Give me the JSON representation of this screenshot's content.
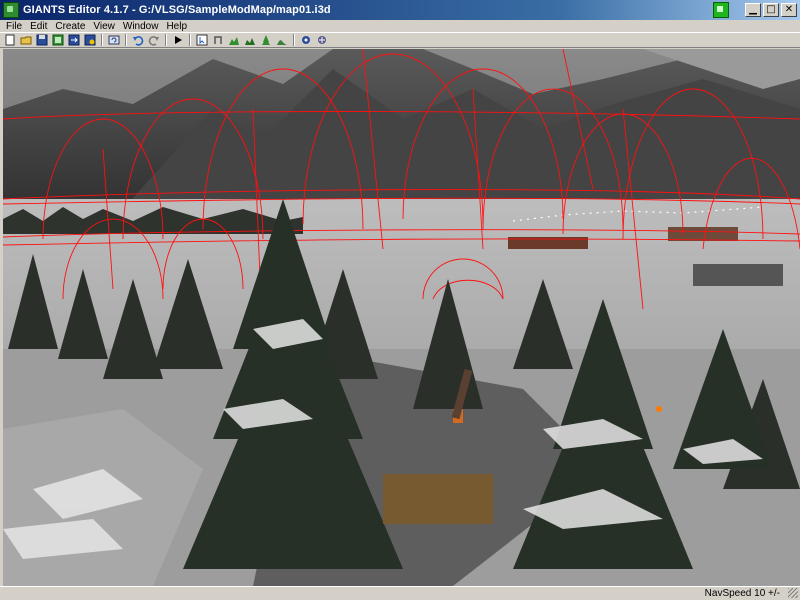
{
  "window": {
    "title": "GIANTS Editor 4.1.7 - G:/VLSG/SampleModMap/map01.i3d",
    "minimize_glyph": "▁",
    "maximize_glyph": "□",
    "close_glyph": "✕"
  },
  "menu": [
    {
      "label": "File"
    },
    {
      "label": "Edit"
    },
    {
      "label": "Create"
    },
    {
      "label": "View"
    },
    {
      "label": "Window"
    },
    {
      "label": "Help"
    }
  ],
  "toolbar": {
    "groups": [
      [
        "new-file-icon",
        "open-file-icon",
        "save-icon",
        "import-icon",
        "export-icon",
        "save-as-icon"
      ],
      [
        "reload-icon"
      ],
      [
        "undo-icon",
        "redo-icon"
      ],
      [
        "play-icon"
      ],
      [
        "select-icon",
        "move-icon",
        "terrain-sculpt-icon",
        "terrain-paint-icon",
        "foliage-paint-icon",
        "terrain-smooth-icon"
      ],
      [
        "settings-icon",
        "snap-icon"
      ]
    ]
  },
  "viewport": {
    "description_colors": {
      "sky": "#7b7b7b",
      "mountain": "#3c3c3c",
      "snow_ground": "#b8b8b8",
      "spline_red": "#ff1010",
      "tree_dark": "#2a2f2a"
    }
  },
  "statusbar": {
    "navspeed": "NavSpeed 10 +/-"
  }
}
